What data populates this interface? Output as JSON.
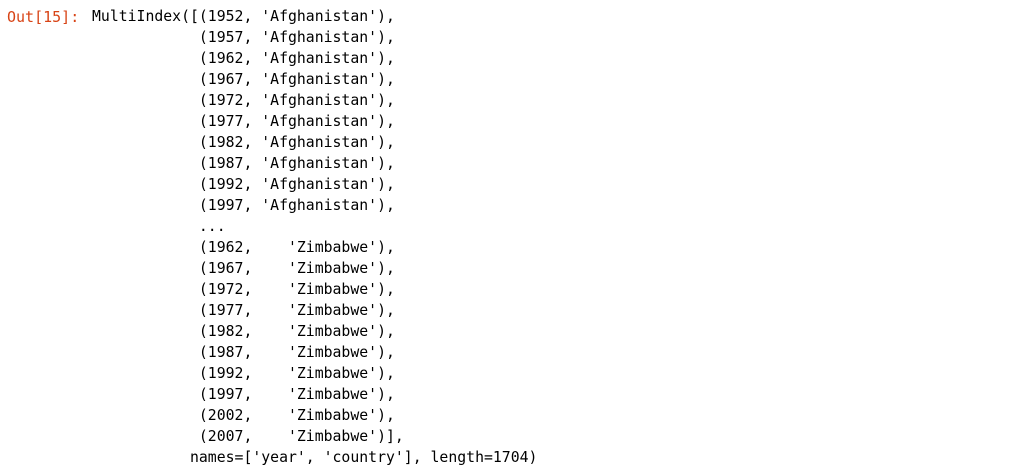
{
  "prompt": {
    "label": "Out[15]:",
    "color": "#d84315"
  },
  "output": {
    "lines": [
      "MultiIndex([(1952, 'Afghanistan'),",
      "            (1957, 'Afghanistan'),",
      "            (1962, 'Afghanistan'),",
      "            (1967, 'Afghanistan'),",
      "            (1972, 'Afghanistan'),",
      "            (1977, 'Afghanistan'),",
      "            (1982, 'Afghanistan'),",
      "            (1987, 'Afghanistan'),",
      "            (1992, 'Afghanistan'),",
      "            (1997, 'Afghanistan'),",
      "            ...",
      "            (1962,    'Zimbabwe'),",
      "            (1967,    'Zimbabwe'),",
      "            (1972,    'Zimbabwe'),",
      "            (1977,    'Zimbabwe'),",
      "            (1982,    'Zimbabwe'),",
      "            (1987,    'Zimbabwe'),",
      "            (1992,    'Zimbabwe'),",
      "            (1997,    'Zimbabwe'),",
      "            (2002,    'Zimbabwe'),",
      "            (2007,    'Zimbabwe')],",
      "           names=['year', 'country'], length=1704)"
    ]
  }
}
